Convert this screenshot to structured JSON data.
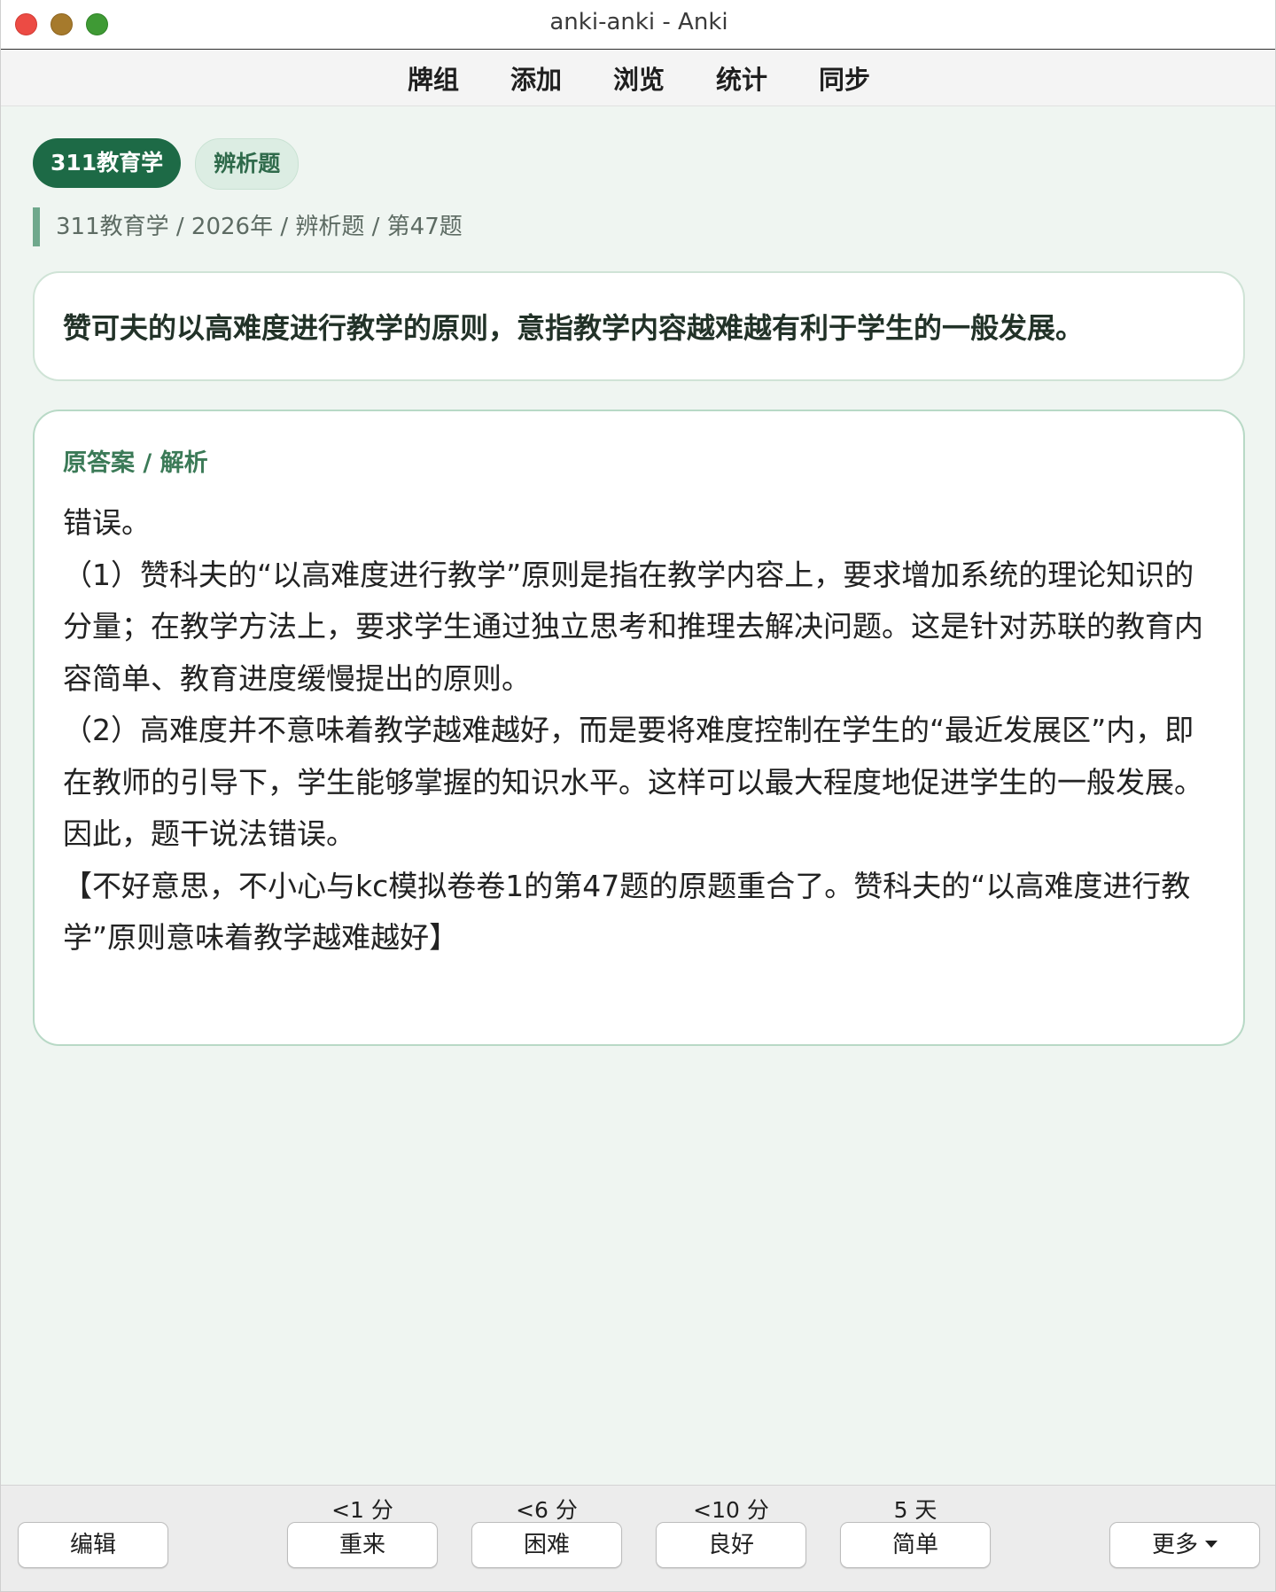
{
  "window": {
    "title": "anki-anki - Anki"
  },
  "toolbar": {
    "items": [
      "牌组",
      "添加",
      "浏览",
      "统计",
      "同步"
    ]
  },
  "card": {
    "tags": [
      "311教育学",
      "辨析题"
    ],
    "breadcrumb": "311教育学 / 2026年 / 辨析题 / 第47题",
    "question": "赞可夫的以高难度进行教学的原则，意指教学内容越难越有利于学生的一般发展。",
    "answer_heading": "原答案 / 解析",
    "answer_paragraphs": [
      "错误。",
      "（1）赞科夫的“以高难度进行教学”原则是指在教学内容上，要求增加系统的理论知识的分量；在教学方法上，要求学生通过独立思考和推理去解决问题。这是针对苏联的教育内容简单、教育进度缓慢提出的原则。",
      "（2）高难度并不意味着教学越难越好，而是要将难度控制在学生的“最近发展区”内，即在教师的引导下，学生能够掌握的知识水平。这样可以最大程度地促进学生的一般发展。",
      "因此，题干说法错误。",
      "【不好意思，不小心与kc模拟卷卷1的第47题的原题重合了。赞科夫的“以高难度进行教学”原则意味着教学越难越好】"
    ]
  },
  "bottom": {
    "edit_label": "编辑",
    "more_label": "更多",
    "answers": [
      {
        "interval": "<1 分",
        "label": "重来"
      },
      {
        "interval": "<6 分",
        "label": "困难"
      },
      {
        "interval": "<10 分",
        "label": "良好"
      },
      {
        "interval": "5 天",
        "label": "简单"
      }
    ]
  },
  "colors": {
    "accent": "#1d6a46",
    "accent_light": "#dcede3",
    "background": "#eff5f1",
    "traffic_close": "#ec4b44",
    "traffic_min": "#a67a2c",
    "traffic_max": "#3f9a35"
  }
}
